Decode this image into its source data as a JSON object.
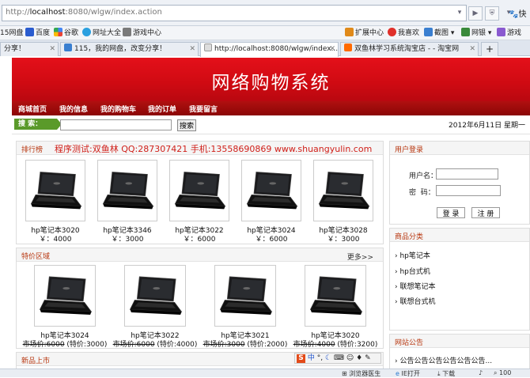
{
  "browser": {
    "url_prefix": "http://",
    "url_host": "localhost",
    "url_rest": ":8080/wlgw/index.action",
    "right_text": "快",
    "bookmarks_left": [
      "15网盘",
      "百度",
      "谷歌",
      "网址大全",
      "游戏中心"
    ],
    "bookmarks_right": [
      "扩展中心",
      "我喜欢",
      "截图",
      "网银",
      "游戏"
    ],
    "tabs": [
      {
        "label": "分享！"
      },
      {
        "label": "115，我的网盘，改变分享！"
      },
      {
        "label": "http://localhost:8080/wlgw/index..."
      },
      {
        "label": "双鱼林学习系统淘宝店 - - 淘宝网"
      }
    ],
    "new_tab": "+"
  },
  "site": {
    "title": "网络购物系统",
    "nav": [
      "商城首页",
      "我的信息",
      "我的购物车",
      "我的订单",
      "我要留言"
    ],
    "search_label": "搜 索：",
    "search_button": "搜索",
    "date": "2012年6月11日  星期一"
  },
  "ranking": {
    "title": "排行榜",
    "notice": "程序测试:双鱼林 QQ:287307421 手机:13558690869 www.shuangyulin.com",
    "products": [
      {
        "name": "hp笔记本3020",
        "price": "￥：4000"
      },
      {
        "name": "hp笔记本3346",
        "price": "￥：3000"
      },
      {
        "name": "hp笔记本3022",
        "price": "￥：6000"
      },
      {
        "name": "hp笔记本3024",
        "price": "￥：6000"
      },
      {
        "name": "hp笔记本3028",
        "price": "￥：3000"
      }
    ]
  },
  "special": {
    "title": "特价区域",
    "more": "更多>>",
    "products": [
      {
        "name": "hp笔记本3024",
        "market": "市场价:6000",
        "special": " (特价:3000)"
      },
      {
        "name": "hp笔记本3022",
        "market": "市场价:6000",
        "special": " (特价:4000)"
      },
      {
        "name": "hp笔记本3021",
        "market": "市场价:3000",
        "special": " (特价:2000)"
      },
      {
        "name": "hp笔记本3020",
        "market": "市场价:4000",
        "special": " (特价:3200)"
      }
    ]
  },
  "new_arrivals": {
    "title": "新品上市"
  },
  "login": {
    "title": "用户登录",
    "username_label": "用户名：",
    "password_label": "密  码：",
    "login_button": "登 录",
    "register_button": "注 册"
  },
  "categories": {
    "title": "商品分类",
    "items": [
      "hp笔记本",
      "hp台式机",
      "联想笔记本",
      "联想台式机"
    ]
  },
  "announcement": {
    "title": "网站公告",
    "text": "公告公告公告公告公告公告..."
  },
  "statusbar": {
    "items": [
      "浏览器医生",
      "IE打开",
      "下载",
      "100"
    ]
  }
}
